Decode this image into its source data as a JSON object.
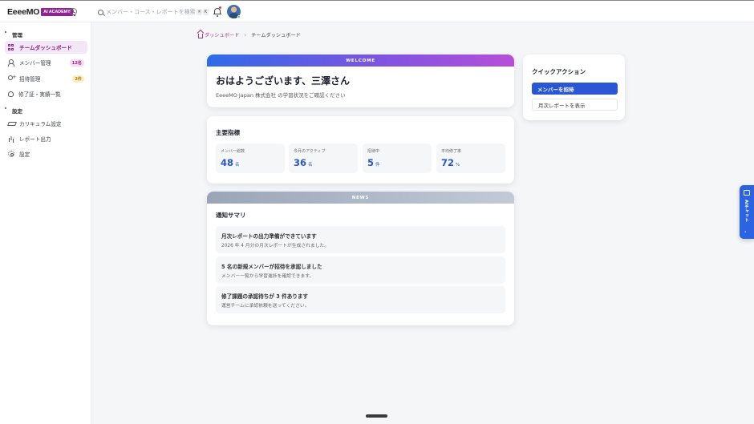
{
  "brand": {
    "name": "EeeeMO",
    "badge": "AI ACADEMY",
    "accent": "#8e2394"
  },
  "search": {
    "placeholder": "メンバー・コース・レポートを検索...",
    "shortcut_key1": "⌘",
    "shortcut_key2": "K"
  },
  "sidebar": {
    "section_manage": "管理",
    "section_settings": "設定",
    "items": [
      {
        "label": "チームダッシュボード",
        "icon": "grid-icon",
        "active": true
      },
      {
        "label": "メンバー管理",
        "icon": "users-icon",
        "badge": "12名"
      },
      {
        "label": "招待管理",
        "icon": "invite-icon",
        "badge": "2件"
      },
      {
        "label": "修了証・実績一覧",
        "icon": "certificate-icon"
      },
      {
        "label": "カリキュラム設定",
        "icon": "graduation-cap-icon"
      },
      {
        "label": "レポート出力",
        "icon": "bar-chart-icon"
      },
      {
        "label": "設定",
        "icon": "gear-icon"
      }
    ]
  },
  "breadcrumb": {
    "home": "ダッシュボード",
    "separator": "›",
    "current": "チームダッシュボード"
  },
  "welcome": {
    "band": "WELCOME",
    "greeting": "おはようございます、三澤さん",
    "subtitle": "EeeeMO Japan 株式会社 の学習状況をご確認ください"
  },
  "metrics": {
    "title": "主要指標",
    "items": [
      {
        "label": "メンバー総数",
        "value": "48",
        "unit": "名"
      },
      {
        "label": "今月のアクティブ",
        "value": "36",
        "unit": "名"
      },
      {
        "label": "招待中",
        "value": "5",
        "unit": "件"
      },
      {
        "label": "平均修了率",
        "value": "72",
        "unit": "%"
      }
    ]
  },
  "news": {
    "band": "NEWS",
    "title": "通知サマリ",
    "items": [
      {
        "title": "月次レポートの出力準備ができています",
        "body": "2026 年 4 月分の月次レポートが生成されました。"
      },
      {
        "title": "5 名の新規メンバーが招待を承認しました",
        "body": "メンバー一覧から学習進捗を確認できます。"
      },
      {
        "title": "修了課題の承認待ちが 3 件あります",
        "body": "運営チームに承認依頼を送ってください。"
      }
    ]
  },
  "quick_actions": {
    "title": "クイックアクション",
    "primary": "メンバーを招待",
    "secondary": "月次レポートを表示"
  },
  "ai_chat": {
    "label": "AIチャット",
    "chevron": "‹",
    "color": "#2b63e2"
  }
}
